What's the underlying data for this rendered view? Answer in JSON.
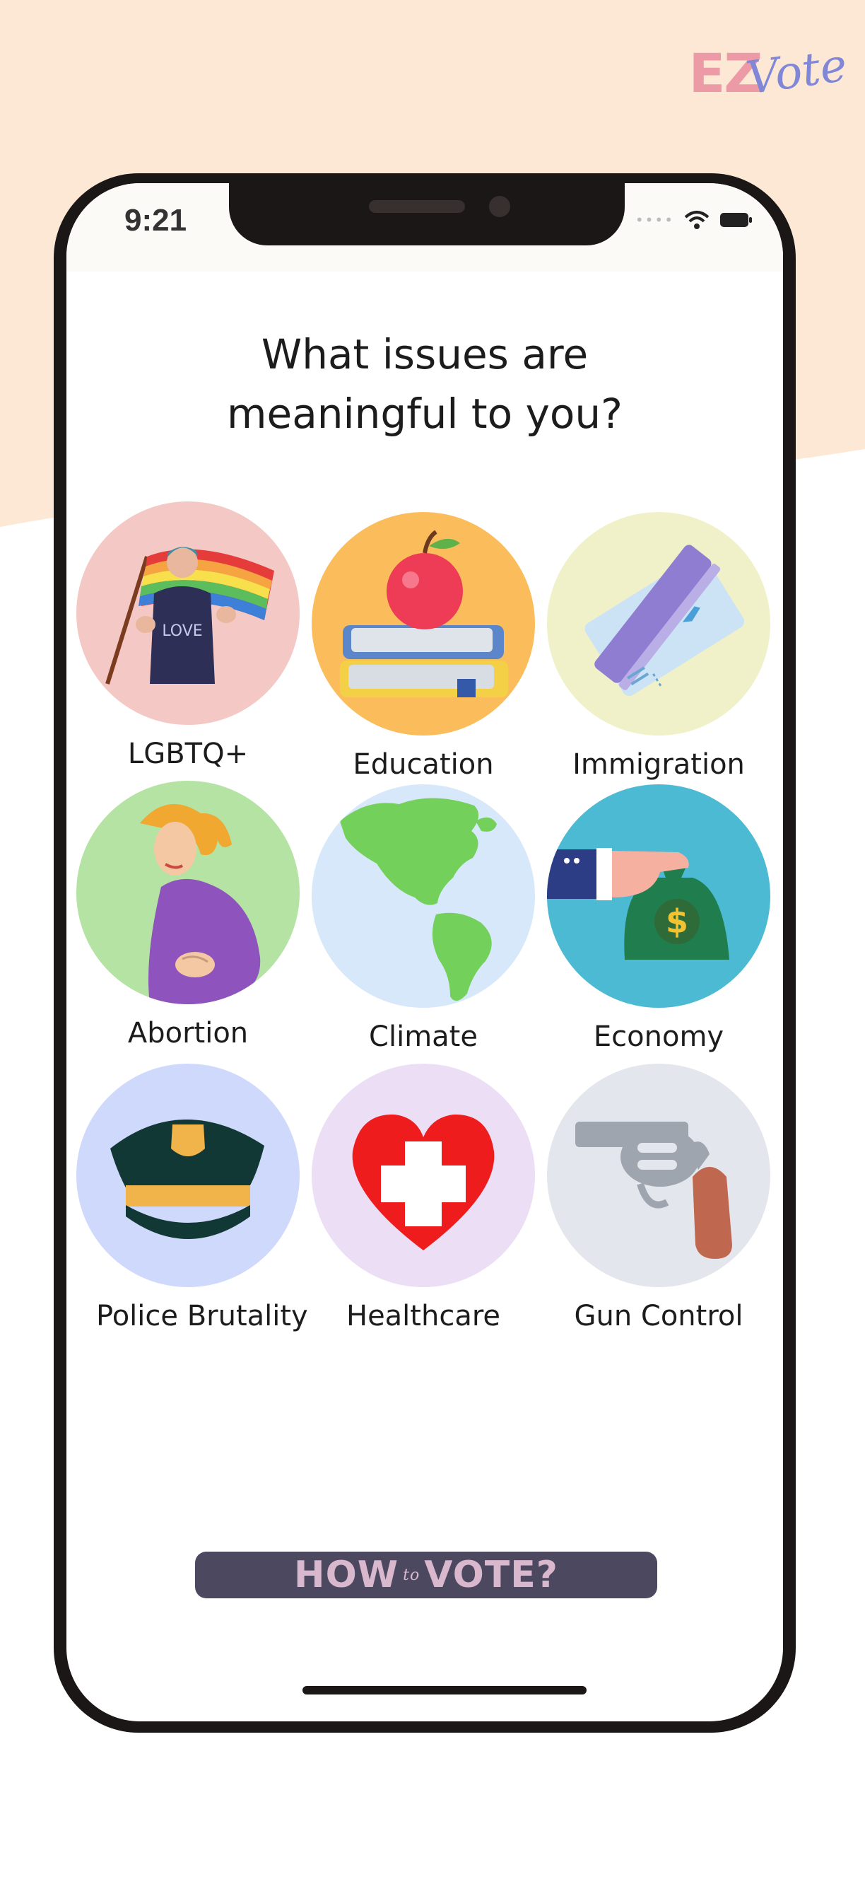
{
  "brand": {
    "prefix": "EZ",
    "script": "Vote"
  },
  "status_bar": {
    "time": "9:21"
  },
  "question": {
    "line1": "What issues are",
    "line2": "meaningful to you?"
  },
  "issues": [
    {
      "label": "LGBTQ+",
      "icon": "pride-flag-icon",
      "color": "#f4c8c4"
    },
    {
      "label": "Education",
      "icon": "books-apple-icon",
      "color": "#fbbd5c"
    },
    {
      "label": "Immigration",
      "icon": "tickets-icon",
      "color": "#f0f1c9"
    },
    {
      "label": "Abortion",
      "icon": "pregnant-woman-icon",
      "color": "#b5e3a3"
    },
    {
      "label": "Climate",
      "icon": "globe-icon",
      "color": "#d8e8fb"
    },
    {
      "label": "Economy",
      "icon": "money-bag-icon",
      "color": "#4dbad3"
    },
    {
      "label": "Police Brutality",
      "icon": "police-cap-icon",
      "color": "#cfd9fc"
    },
    {
      "label": "Healthcare",
      "icon": "heart-cross-icon",
      "color": "#ebdef5"
    },
    {
      "label": "Gun Control",
      "icon": "revolver-icon",
      "color": "#e3e6ec"
    }
  ],
  "cta": {
    "left": "HOW",
    "middle": "to",
    "right": "VOTE?"
  },
  "colors": {
    "background_blob": "#fde8d6",
    "phone_frame": "#1b1716",
    "cta_bg": "#4b4860",
    "cta_text": "#d9b7cc"
  }
}
